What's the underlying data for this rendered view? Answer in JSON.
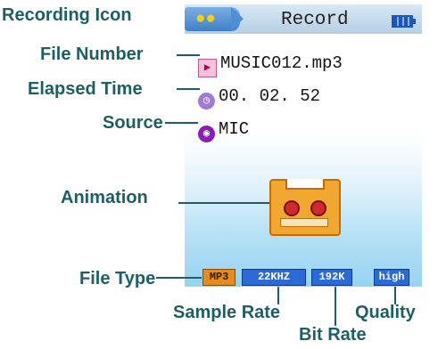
{
  "callouts": {
    "recording_icon": "Recording Icon",
    "file_number": "File Number",
    "elapsed_time": "Elapsed Time",
    "source": "Source",
    "animation": "Animation",
    "file_type": "File Type",
    "sample_rate": "Sample Rate",
    "quality": "Quality",
    "bit_rate": "Bit Rate"
  },
  "screen": {
    "title": "Record",
    "file_name": "MUSIC012.mp3",
    "elapsed": "00. 02. 52",
    "source": "MIC",
    "badges": {
      "file_type": "MP3",
      "sample_rate": "22KHZ",
      "bit_rate": "192K",
      "quality": "high"
    }
  },
  "icons": {
    "recording": "recording-icon",
    "file": "speaker-file-icon",
    "clock": "clock-icon",
    "source": "microphone-icon",
    "battery": "battery-icon",
    "cassette": "cassette-icon"
  },
  "colors": {
    "callout_text": "#1f5e63",
    "badge_blue": "#2a69d6",
    "badge_orange": "#e58c1a"
  }
}
